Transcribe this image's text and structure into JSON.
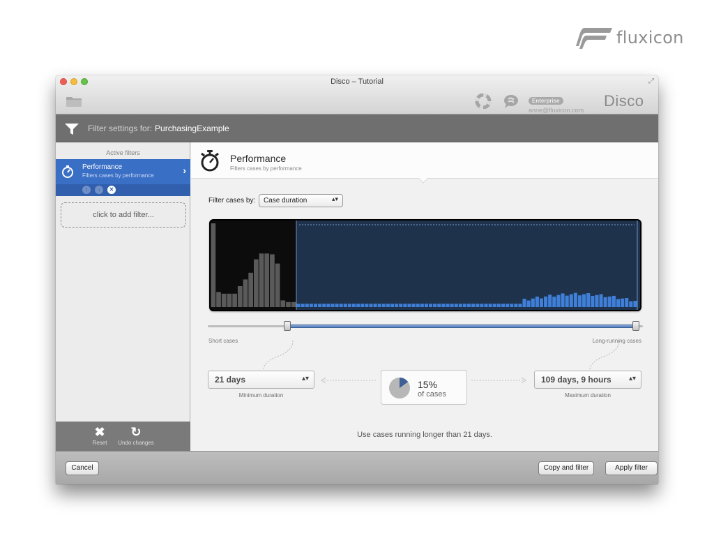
{
  "brand": {
    "name": "fluxicon"
  },
  "window": {
    "title": "Disco – Tutorial"
  },
  "toolbar": {
    "edition_badge": "Enterprise",
    "user_email": "anne@fluxicon.com",
    "app_name": "Disco"
  },
  "filter_header": {
    "label": "Filter settings for:",
    "dataset": "PurchasingExample"
  },
  "sidebar": {
    "heading": "Active filters",
    "active_item": {
      "title": "Performance",
      "subtitle": "Filters cases by performance"
    },
    "add_filter_label": "click to add filter...",
    "bottom_actions": [
      {
        "label": "Reset",
        "icon": "close-icon"
      },
      {
        "label": "Undo changes",
        "icon": "undo-icon"
      }
    ]
  },
  "panel": {
    "title": "Performance",
    "subtitle": "Filters cases by performance",
    "filter_by_label": "Filter cases by:",
    "filter_by_value": "Case duration",
    "short_label": "Short cases",
    "long_label": "Long-running cases",
    "min_value": "21 days",
    "min_caption": "Minimum duration",
    "max_value": "109 days, 9 hours",
    "max_caption": "Maximum duration",
    "percent": "15%",
    "percent_caption": "of cases",
    "percent_fraction": 0.15,
    "selection_start_fraction": 0.2,
    "selection_end_fraction": 1.0,
    "summary": "Use cases running longer than 21 days.",
    "histogram": [
      100,
      18,
      16,
      16,
      16,
      25,
      33,
      41,
      57,
      64,
      64,
      63,
      52,
      8,
      6,
      6
    ]
  },
  "footer": {
    "cancel": "Cancel",
    "copy_filter": "Copy and filter",
    "apply_filter": "Apply filter"
  },
  "colors": {
    "accent": "#3a6fc6",
    "selection_bg": "#1f324b",
    "bar_selected": "#3f7fd8",
    "bar_unselected": "#5a5a5a"
  }
}
